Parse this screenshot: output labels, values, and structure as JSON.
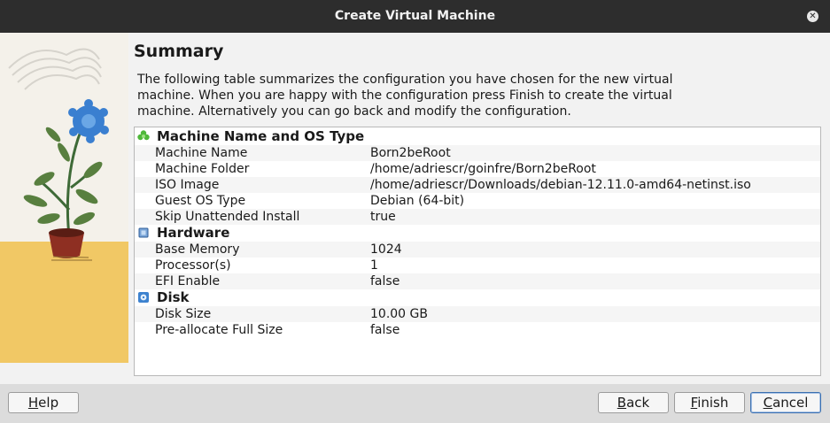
{
  "window": {
    "title": "Create Virtual Machine"
  },
  "page": {
    "heading": "Summary",
    "description": "The following table summarizes the configuration you have chosen for the new virtual machine. When you are happy with the configuration press Finish to create the virtual machine. Alternatively you can go back and modify the configuration."
  },
  "summary": {
    "groups": [
      {
        "title": "Machine Name and OS Type",
        "icon": "os-type-icon",
        "rows": [
          {
            "label": "Machine Name",
            "value": "Born2beRoot"
          },
          {
            "label": "Machine Folder",
            "value": "/home/adriescr/goinfre/Born2beRoot"
          },
          {
            "label": "ISO Image",
            "value": "/home/adriescr/Downloads/debian-12.11.0-amd64-netinst.iso"
          },
          {
            "label": "Guest OS Type",
            "value": "Debian (64-bit)"
          },
          {
            "label": "Skip Unattended Install",
            "value": "true"
          }
        ]
      },
      {
        "title": "Hardware",
        "icon": "chip-icon",
        "rows": [
          {
            "label": "Base Memory",
            "value": "1024"
          },
          {
            "label": "Processor(s)",
            "value": "1"
          },
          {
            "label": "EFI Enable",
            "value": "false"
          }
        ]
      },
      {
        "title": "Disk",
        "icon": "disk-icon",
        "rows": [
          {
            "label": "Disk Size",
            "value": "10.00 GB"
          },
          {
            "label": "Pre-allocate Full Size",
            "value": "false"
          }
        ]
      }
    ]
  },
  "buttons": {
    "help": {
      "accel": "H",
      "rest": "elp"
    },
    "back": {
      "accel": "B",
      "rest": "ack"
    },
    "finish": {
      "accel": "F",
      "rest": "inish"
    },
    "cancel": {
      "accel": "C",
      "rest": "ancel"
    }
  },
  "colors": {
    "titlebar": "#2d2d2d",
    "default_button_border": "#3a6fb0",
    "illustration_floor": "#f1c865"
  }
}
